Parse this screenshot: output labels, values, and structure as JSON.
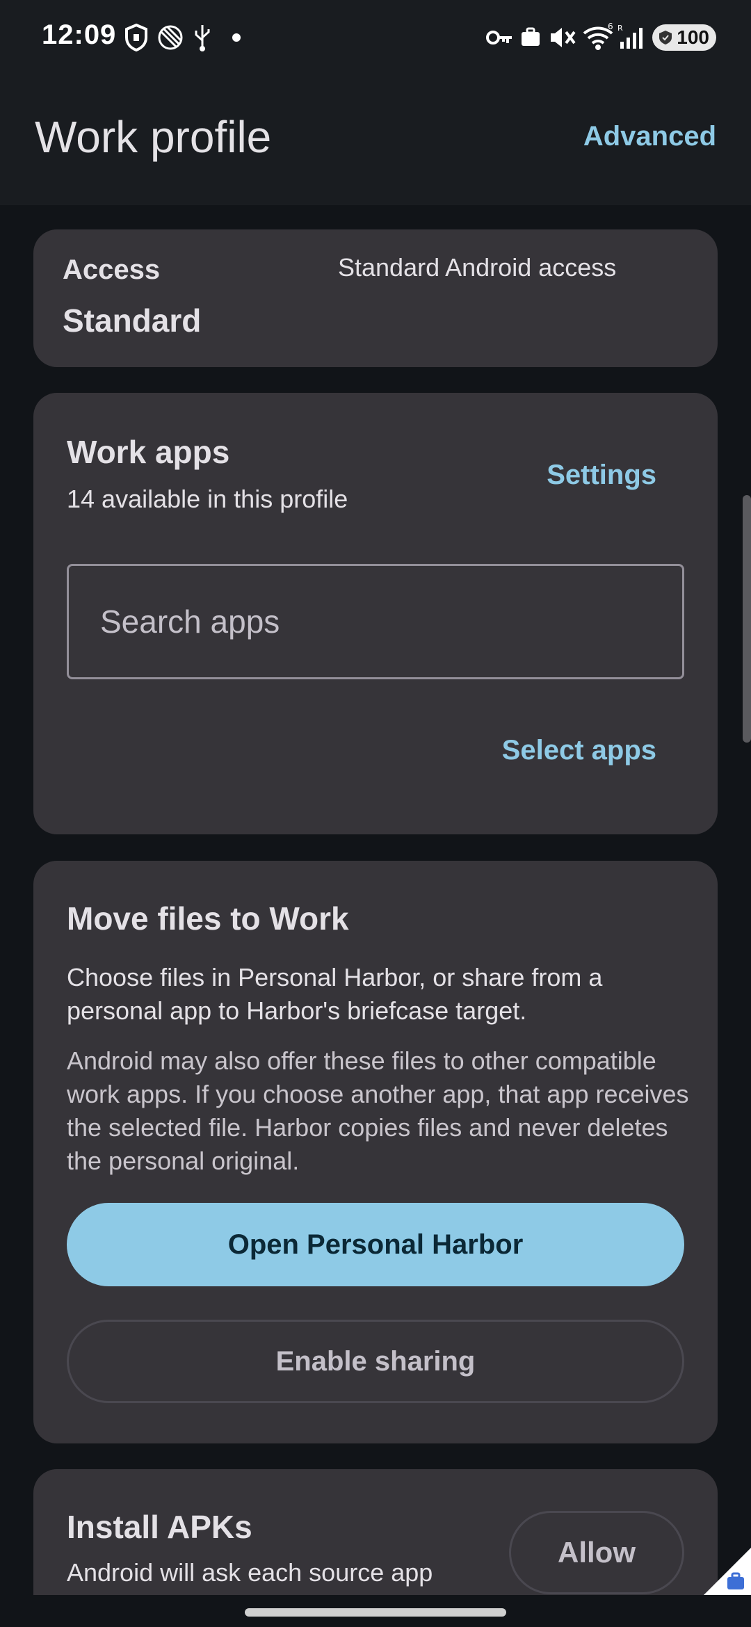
{
  "status_bar": {
    "time": "12:09",
    "battery": "100",
    "icons": [
      "shield-icon",
      "satellite-icon",
      "usb-icon",
      "dot-icon",
      "vpn-key-icon",
      "work-briefcase-icon",
      "vibrate-mute-icon",
      "wifi-icon",
      "signal-icon",
      "battery-icon"
    ]
  },
  "app_bar": {
    "title": "Work profile",
    "action": "Advanced"
  },
  "access_card": {
    "label": "Access",
    "value": "Standard",
    "description": "Standard Android access"
  },
  "apps_card": {
    "heading": "Work apps",
    "subtitle": "14 available in this profile",
    "settings_link": "Settings",
    "search_placeholder": "Search apps",
    "select_link": "Select apps"
  },
  "move_card": {
    "heading": "Move files to Work",
    "body1": "Choose files in Personal Harbor, or share from a personal app to Harbor's briefcase target.",
    "body2": "Android may also offer these files to other compatible work apps. If you choose another app, that app receives the selected file. Harbor copies files and never deletes the personal original.",
    "primary_button": "Open Personal Harbor",
    "secondary_button": "Enable sharing"
  },
  "apk_card": {
    "heading": "Install APKs",
    "subtitle": "Android will ask each source app",
    "button": "Allow"
  },
  "colors": {
    "accent": "#8ecae6",
    "card": "#363439",
    "background": "#111418",
    "surface": "#191c20"
  }
}
